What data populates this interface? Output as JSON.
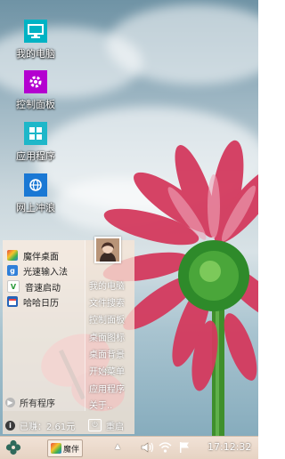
{
  "desktop": {
    "icons": [
      {
        "label": "我的电脑",
        "icon": "monitor-icon",
        "color": "#00b3c4"
      },
      {
        "label": "控制面板",
        "icon": "gear-icon",
        "color": "#b400d0"
      },
      {
        "label": "应用程序",
        "icon": "apps-grid-icon",
        "color": "#1eb7c9"
      },
      {
        "label": "网上冲浪",
        "icon": "globe-icon",
        "color": "#1a78d4"
      }
    ]
  },
  "start_menu": {
    "programs": [
      {
        "label": "魔伴桌面",
        "icon": "moban-logo-icon"
      },
      {
        "label": "光速输入法",
        "icon": "input-method-icon"
      },
      {
        "label": "音速启动",
        "icon": "vstart-icon"
      },
      {
        "label": "哈哈日历",
        "icon": "calendar-icon"
      }
    ],
    "all_programs_label": "所有程序",
    "right_items": [
      "我的电脑",
      "文件搜索",
      "控制面板",
      "桌面图标",
      "桌面背景",
      "开始菜单",
      "应用程序",
      "关于.."
    ],
    "status_text": "已赚：2.61元",
    "restart_label": "重启"
  },
  "taskbar": {
    "task_label": "魔伴",
    "clock": "17:12:32"
  },
  "colors": {
    "menu_bg": "#f7e6d6",
    "taskbar_bg": "#efe0d3"
  }
}
